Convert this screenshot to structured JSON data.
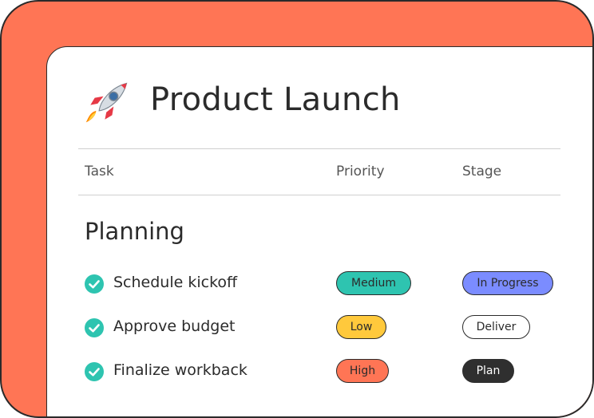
{
  "title": "Product Launch",
  "icons": {
    "title_icon": "rocket-icon",
    "done_icon": "check-circle-icon"
  },
  "columns": {
    "task": "Task",
    "priority": "Priority",
    "stage": "Stage"
  },
  "group": {
    "title": "Planning"
  },
  "tasks": [
    {
      "name": "Schedule kickoff",
      "priority": "Medium",
      "stage": "In Progress"
    },
    {
      "name": "Approve budget",
      "priority": "Low",
      "stage": "Deliver"
    },
    {
      "name": "Finalize workback",
      "priority": "High",
      "stage": "Plan"
    }
  ],
  "colors": {
    "frame": "#ff7555",
    "check": "#2ec4b0",
    "medium": "#2ec4b0",
    "low": "#ffc93c",
    "high": "#ff7555",
    "in_progress": "#7b8cff",
    "deliver": "#ffffff",
    "plan": "#2f2f2f"
  }
}
